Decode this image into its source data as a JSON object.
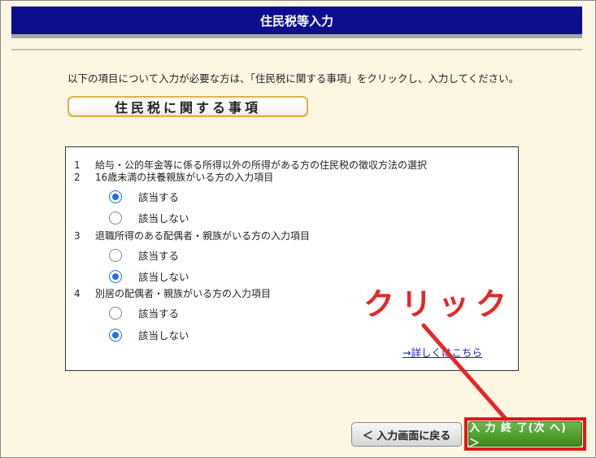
{
  "header": {
    "title": "住民税等入力"
  },
  "instruction": "以下の項目について入力が必要な方は、「住民税に関する事項」をクリックし、入力してください。",
  "section_button": {
    "label": "住民税に関する事項"
  },
  "panel": {
    "items": [
      {
        "number": "1",
        "text": "給与・公的年金等に係る所得以外の所得がある方の住民税の徴収方法の選択"
      },
      {
        "number": "2",
        "text": "16歳未満の扶養親族がいる方の入力項目",
        "options": [
          {
            "label": "該当する",
            "checked": true
          },
          {
            "label": "該当しない",
            "checked": false
          }
        ]
      },
      {
        "number": "3",
        "text": "退職所得のある配偶者・親族がいる方の入力項目",
        "options": [
          {
            "label": "該当する",
            "checked": false
          },
          {
            "label": "該当しない",
            "checked": true
          }
        ]
      },
      {
        "number": "4",
        "text": "別居の配偶者・親族がいる方の入力項目",
        "options": [
          {
            "label": "該当する",
            "checked": false
          },
          {
            "label": "該当しない",
            "checked": true
          }
        ]
      }
    ],
    "detail_link": "→詳しくはこちら"
  },
  "annotation": {
    "label": "クリック",
    "color": "#e32828"
  },
  "footer": {
    "back_label": "＜ 入力画面に戻る",
    "next_label": "入 力 終 了(次 へ) ＞"
  },
  "colors": {
    "title_bar": "#0d0e8e",
    "next_button": "#4a9c2a",
    "highlight": "#e01818",
    "link": "#1b19c8"
  }
}
